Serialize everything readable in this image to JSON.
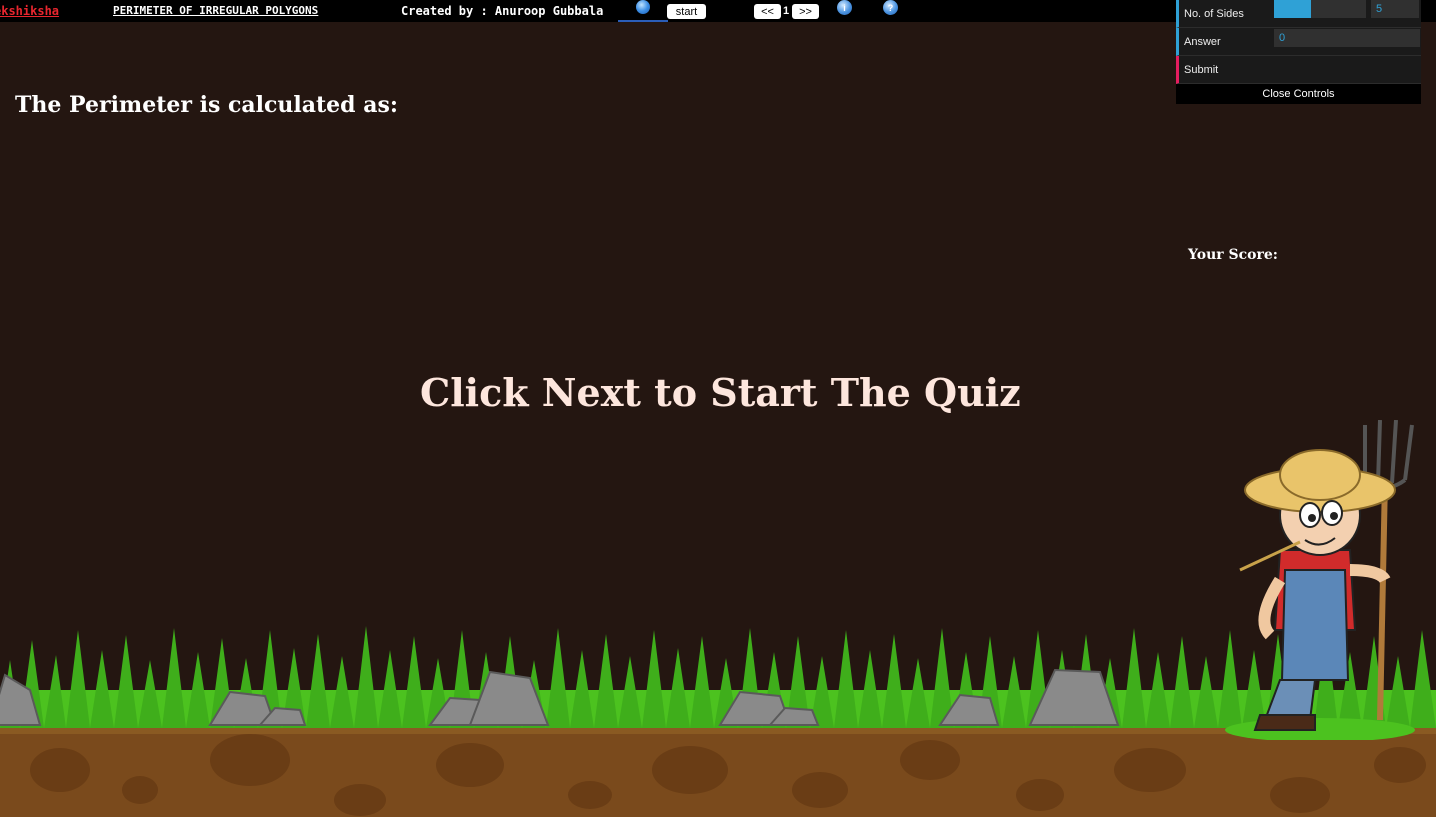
{
  "topbar": {
    "brand": "ekshiksha",
    "sim_title": "PERIMETER OF IRREGULAR POLYGONS",
    "creator": "Created by : Anuroop Gubbala",
    "start_label": "start",
    "prev_label": "<<",
    "page_number": "1",
    "next_label": ">>",
    "info_icon": "i",
    "help_icon": "?"
  },
  "controls": {
    "sides_label": "No. of Sides",
    "sides_value": "5",
    "sides_fraction": 0.4,
    "answer_label": "Answer",
    "answer_value": "0",
    "submit_label": "Submit",
    "close_label": "Close Controls",
    "accent_color": "#2fa1d6",
    "submit_color": "#e61d5f"
  },
  "main": {
    "heading": "The Perimeter is calculated as:",
    "score_label": "Your Score:",
    "prompt": "Click Next to Start The Quiz"
  }
}
